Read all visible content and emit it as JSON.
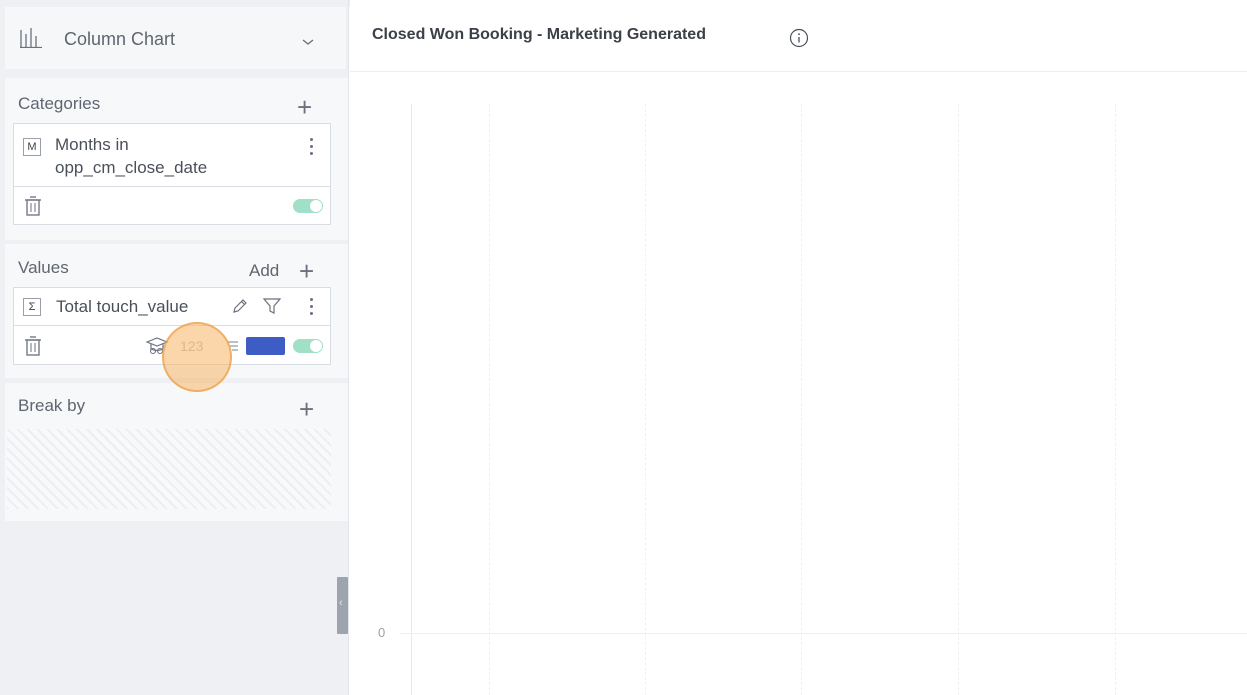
{
  "panel": {
    "chart_type_label": "Column Chart",
    "categories": {
      "title": "Categories",
      "field_badge": "M",
      "field_label_line1": "Months in",
      "field_label_line2": "opp_cm_close_date"
    },
    "values": {
      "title": "Values",
      "add_label": "Add",
      "field_badge": "Σ",
      "field_label": "Total touch_value",
      "format_label": "123",
      "series_color": "#3d5cc4"
    },
    "break_by": {
      "title": "Break by"
    }
  },
  "chart": {
    "title": "Closed Won Booking - Marketing Generated",
    "y_tick": "0"
  },
  "colors": {
    "toggle_on": "#9fe0c6",
    "series": "#3d5cc4",
    "cursor_highlight": "#f6b464"
  }
}
